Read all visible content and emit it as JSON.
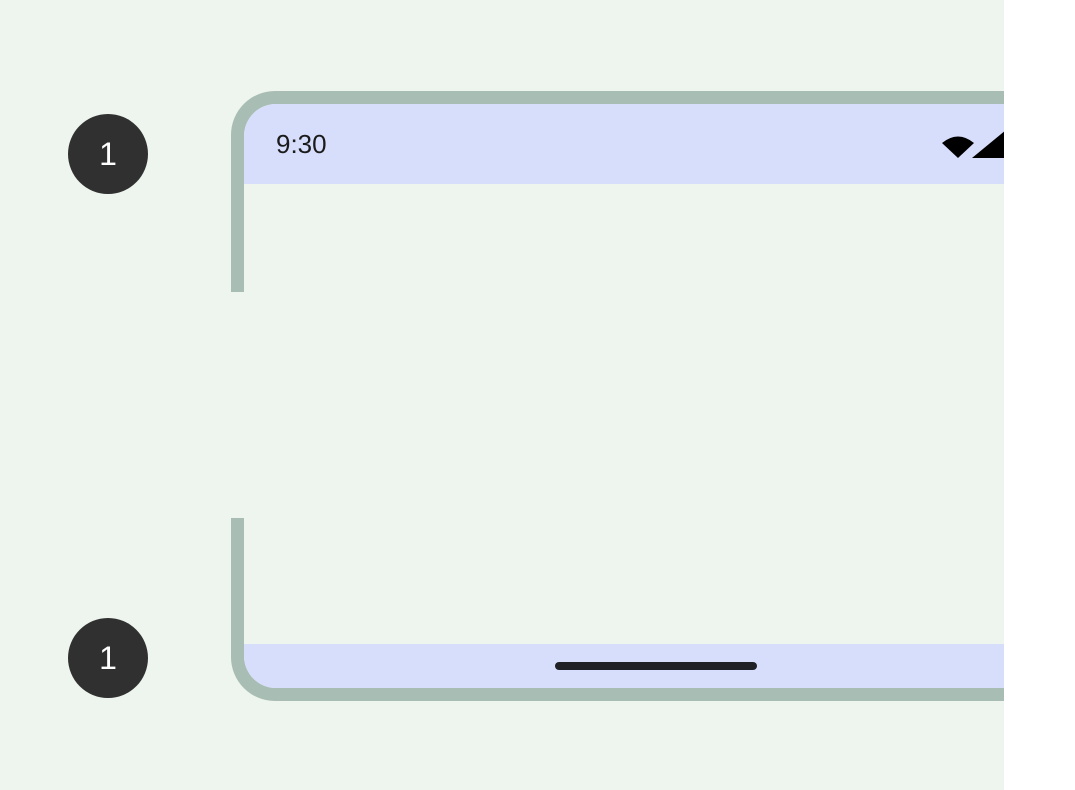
{
  "callouts": {
    "top": "1",
    "bottom": "1"
  },
  "status_bar": {
    "time": "9:30",
    "icons": [
      "wifi-icon",
      "signal-icon"
    ]
  },
  "nav_bar": {
    "handle": "gesture-handle"
  },
  "colors": {
    "background": "#edf5ee",
    "frame": "#a8bdb3",
    "system_bars": "#d7defb",
    "callout": "#303030",
    "handle": "#1f2126"
  }
}
